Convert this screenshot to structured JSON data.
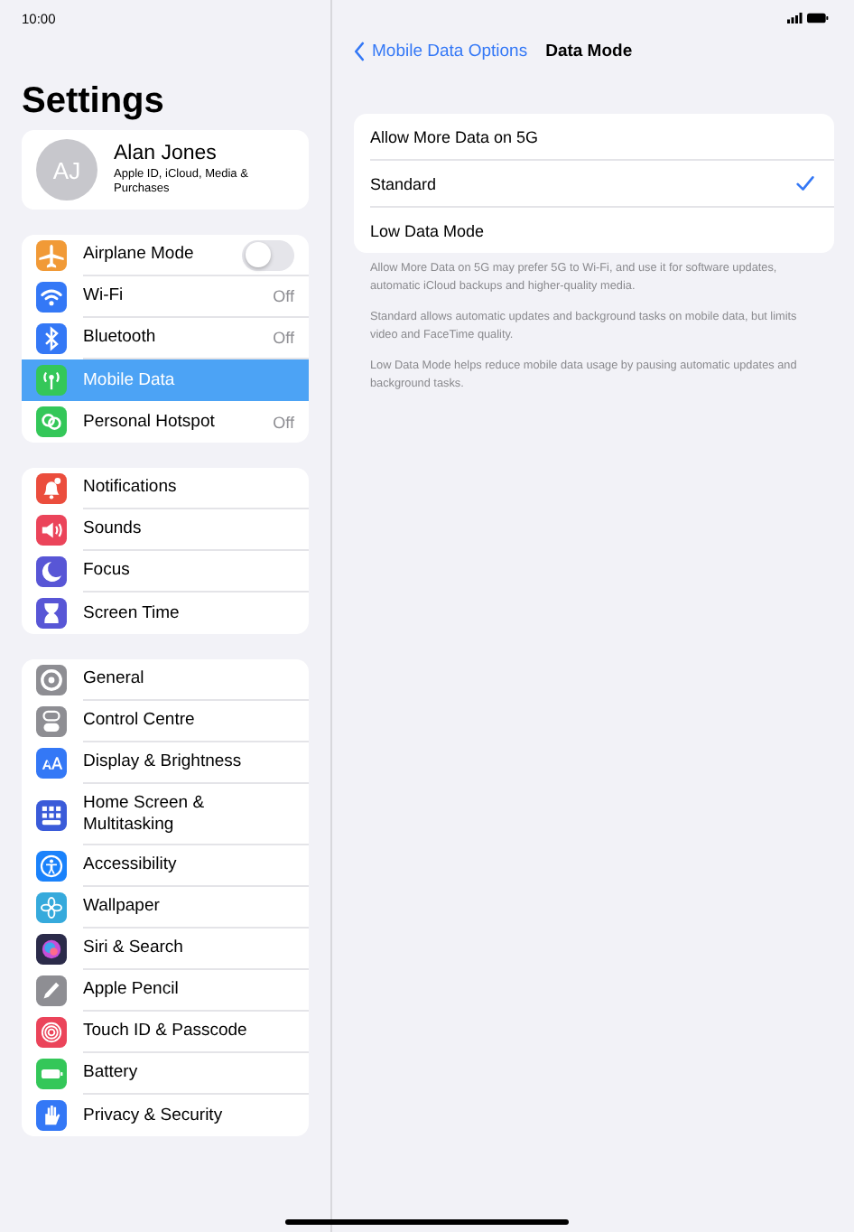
{
  "status_bar": {
    "time": "10:00"
  },
  "sidebar": {
    "title": "Settings",
    "profile": {
      "initials": "AJ",
      "name": "Alan Jones",
      "subtitle": "Apple ID, iCloud, Media & Purchases"
    },
    "groups": [
      {
        "items": [
          {
            "label": "Airplane Mode",
            "kind": "toggle",
            "on": false,
            "color": "#f19a37",
            "selected": false
          },
          {
            "label": "Wi-Fi",
            "kind": "value",
            "value": "Off",
            "color": "#3478f6",
            "selected": false
          },
          {
            "label": "Bluetooth",
            "kind": "value",
            "value": "Off",
            "color": "#3478f6",
            "selected": false
          },
          {
            "label": "Mobile Data",
            "kind": "plain",
            "color": "#34c759",
            "selected": true
          },
          {
            "label": "Personal Hotspot",
            "kind": "value",
            "value": "Off",
            "color": "#34c759",
            "selected": false
          }
        ]
      },
      {
        "items": [
          {
            "label": "Notifications",
            "kind": "plain",
            "color": "#eb4d3d",
            "selected": false
          },
          {
            "label": "Sounds",
            "kind": "plain",
            "color": "#eb445a",
            "selected": false
          },
          {
            "label": "Focus",
            "kind": "plain",
            "color": "#5856d6",
            "selected": false
          },
          {
            "label": "Screen Time",
            "kind": "plain",
            "color": "#5856d6",
            "selected": false
          }
        ]
      },
      {
        "items": [
          {
            "label": "General",
            "kind": "plain",
            "color": "#8e8e93",
            "selected": false
          },
          {
            "label": "Control Centre",
            "kind": "plain",
            "color": "#8e8e93",
            "selected": false
          },
          {
            "label": "Display & Brightness",
            "kind": "plain",
            "color": "#3478f6",
            "selected": false
          },
          {
            "label": "Home Screen & Multitasking",
            "kind": "plain",
            "color": "#3a5bd9",
            "selected": false
          },
          {
            "label": "Accessibility",
            "kind": "plain",
            "color": "#1a82fb",
            "selected": false
          },
          {
            "label": "Wallpaper",
            "kind": "plain",
            "color": "#36aadc",
            "selected": false
          },
          {
            "label": "Siri & Search",
            "kind": "plain",
            "color": "#2b2b4a",
            "selected": false
          },
          {
            "label": "Apple Pencil",
            "kind": "plain",
            "color": "#8e8e93",
            "selected": false
          },
          {
            "label": "Touch ID & Passcode",
            "kind": "plain",
            "color": "#eb445a",
            "selected": false
          },
          {
            "label": "Battery",
            "kind": "plain",
            "color": "#34c759",
            "selected": false
          },
          {
            "label": "Privacy & Security",
            "kind": "plain",
            "color": "#3478f6",
            "selected": false
          }
        ]
      }
    ]
  },
  "detail": {
    "back": "Mobile Data Options",
    "title": "Data Mode",
    "options": [
      {
        "label": "Allow More Data on 5G",
        "selected": false
      },
      {
        "label": "Standard",
        "selected": true
      },
      {
        "label": "Low Data Mode",
        "selected": false
      }
    ],
    "notes": [
      "Allow More Data on 5G may prefer 5G to Wi-Fi, and use it for software updates, automatic iCloud backups and higher-quality media.",
      "Standard allows automatic updates and background tasks on mobile data, but limits video and FaceTime quality.",
      "Low Data Mode helps reduce mobile data usage by pausing automatic updates and background tasks."
    ]
  }
}
